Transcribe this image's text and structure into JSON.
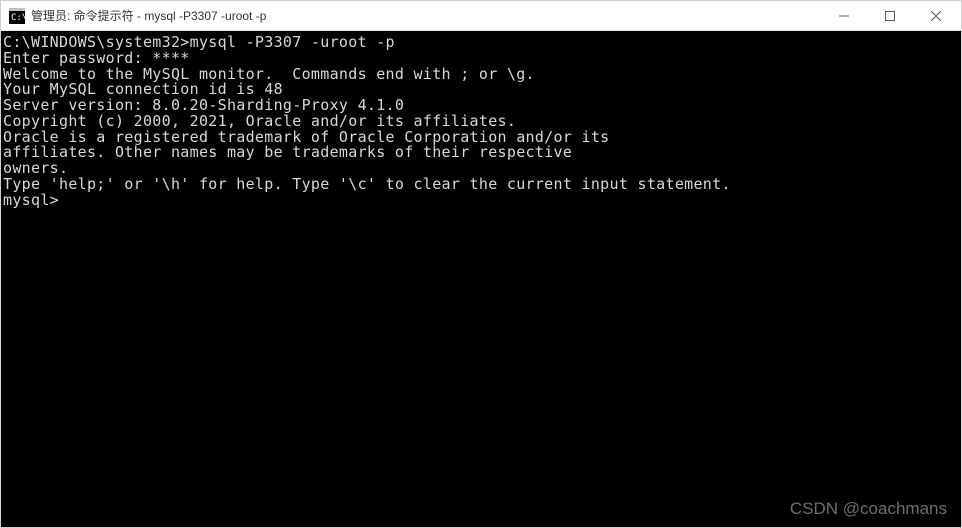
{
  "window": {
    "title": "管理员: 命令提示符 - mysql  -P3307 -uroot -p"
  },
  "terminal": {
    "lines": {
      "blank": "",
      "l1": "C:\\WINDOWS\\system32>mysql -P3307 -uroot -p",
      "l2": "Enter password: ****",
      "l3": "Welcome to the MySQL monitor.  Commands end with ; or \\g.",
      "l4": "Your MySQL connection id is 48",
      "l5": "Server version: 8.0.20-Sharding-Proxy 4.1.0",
      "l6": "Copyright (c) 2000, 2021, Oracle and/or its affiliates.",
      "l7": "Oracle is a registered trademark of Oracle Corporation and/or its",
      "l8": "affiliates. Other names may be trademarks of their respective",
      "l9": "owners.",
      "l10": "Type 'help;' or '\\h' for help. Type '\\c' to clear the current input statement.",
      "l11": "mysql>"
    }
  },
  "watermark": "CSDN @coachmans"
}
